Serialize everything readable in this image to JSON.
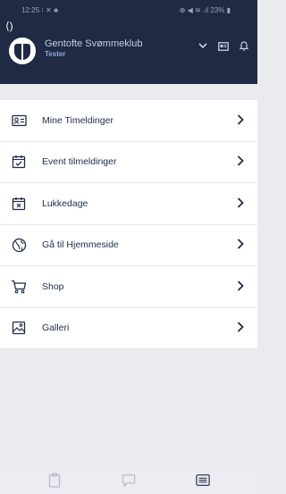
{
  "status_bar": {
    "time": "12:25",
    "left_icons": "⁝ ✕ ♣",
    "right_icons": "⊕ ◀ ≋ .ıl 23% ▮"
  },
  "back": "⟨)",
  "header": {
    "club_name": "Gentofte Svømmeklub",
    "sub_title": "Tester"
  },
  "menu": {
    "items": [
      {
        "label": "Mine Timeldinger",
        "icon": "id-card-icon"
      },
      {
        "label": "Event tilmeldinger",
        "icon": "calendar-check-icon"
      },
      {
        "label": "Lukkedage",
        "icon": "calendar-x-icon"
      },
      {
        "label": "Gå til Hjemmeside",
        "icon": "globe-icon"
      },
      {
        "label": "Shop",
        "icon": "cart-icon"
      },
      {
        "label": "Galleri",
        "icon": "image-icon"
      }
    ]
  },
  "colors": {
    "header_bg": "#1f2a44",
    "accent": "#1f2a44",
    "page_bg": "#e9ebef"
  }
}
